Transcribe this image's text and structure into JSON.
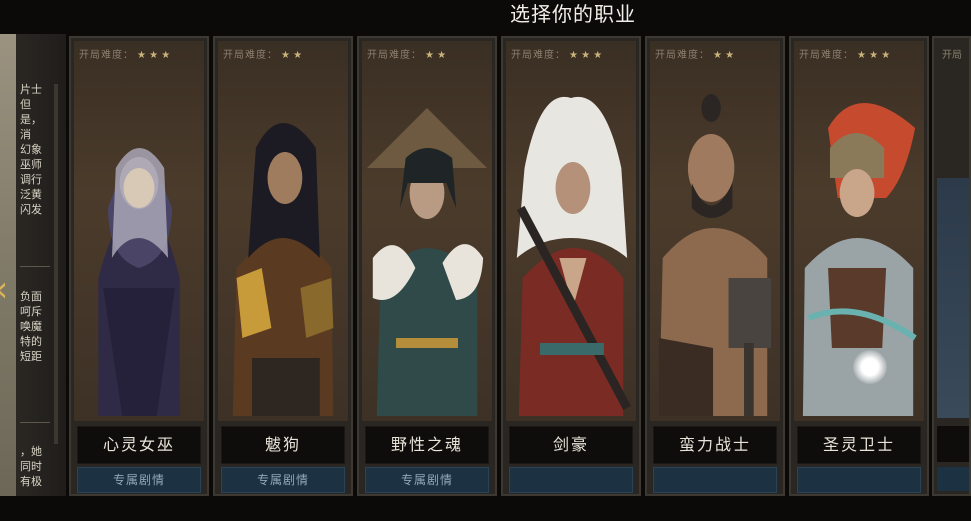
{
  "header": {
    "title": "选择你的职业"
  },
  "side_panel": {
    "text_blocks": [
      "片士\n但是，\n消\n幻象\n巫师\n调行\n泛黄\n闪发",
      "负面\n呵斥\n唤魔\n特的\n短距",
      "，她\n同时\n有极"
    ],
    "arrow_icon": "chevron-left-icon"
  },
  "difficulty_label": "开局难度：",
  "story_label": "专属剧情",
  "cards": [
    {
      "name": "心灵女巫",
      "stars": "★ ★ ★",
      "story": true,
      "palette": [
        "#3a3553",
        "#a8a4b5",
        "#2a2740"
      ]
    },
    {
      "name": "魃狗",
      "stars": "★ ★",
      "story": true,
      "palette": [
        "#5b3a22",
        "#1f1b24",
        "#c89b3a"
      ]
    },
    {
      "name": "野性之魂",
      "stars": "★ ★",
      "story": true,
      "palette": [
        "#2f4a48",
        "#e8e4dc",
        "#1e2a2c"
      ]
    },
    {
      "name": "剑豪",
      "stars": "★ ★ ★",
      "story": false,
      "palette": [
        "#e8e6e1",
        "#7a2b24",
        "#2a2422"
      ]
    },
    {
      "name": "蛮力战士",
      "stars": "★ ★",
      "story": false,
      "palette": [
        "#8d6a4e",
        "#4a4440",
        "#2b2623"
      ]
    },
    {
      "name": "圣灵卫士",
      "stars": "★ ★ ★",
      "story": false,
      "palette": [
        "#c64a2e",
        "#9aa3a6",
        "#5a3a2a"
      ]
    }
  ],
  "partial_card": {
    "difficulty_label_partial": "开局"
  }
}
